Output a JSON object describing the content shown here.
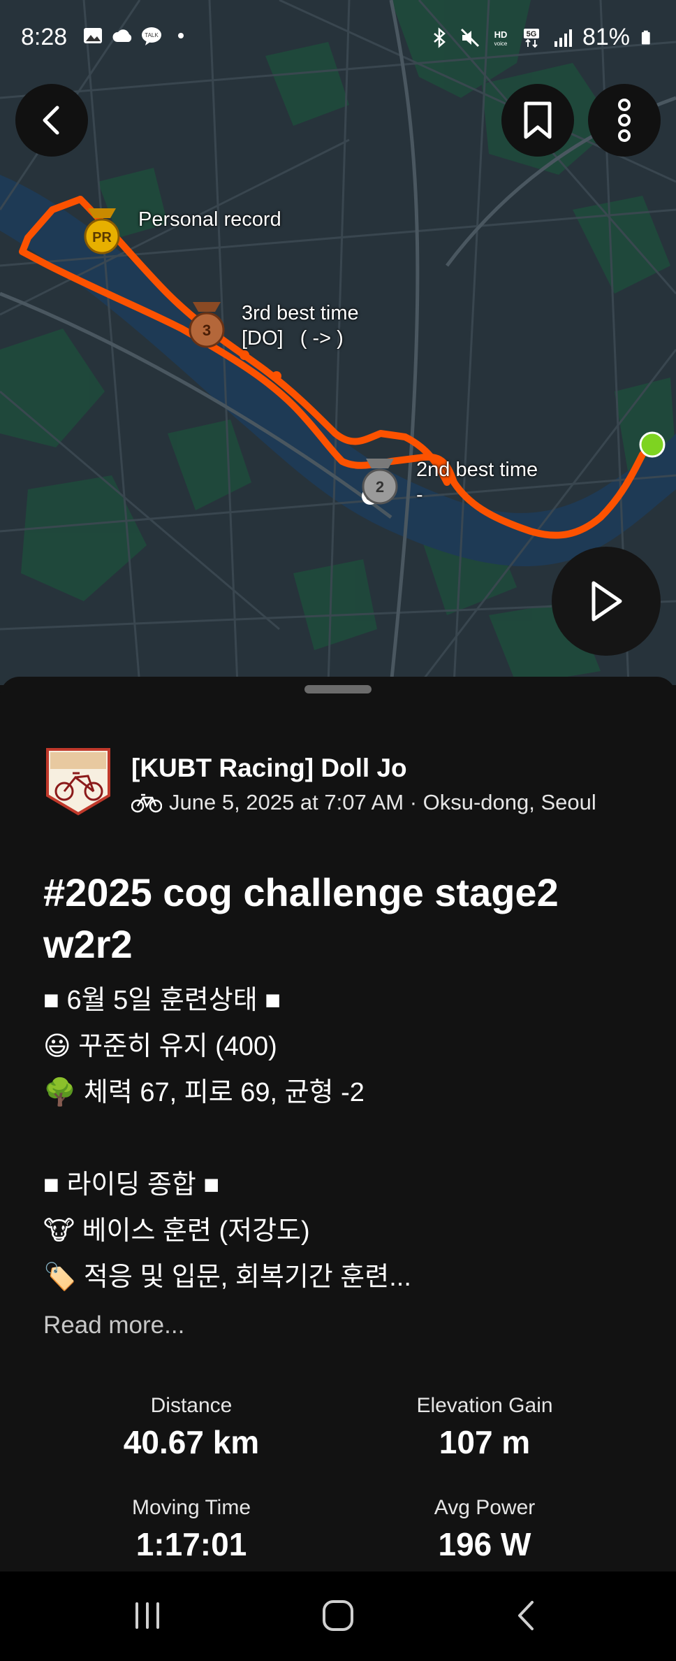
{
  "status_bar": {
    "time": "8:28",
    "battery": "81%",
    "left_icons": [
      "image-icon",
      "cloud-icon",
      "talk-icon",
      "dot-icon"
    ],
    "right_icons": [
      "bluetooth-icon",
      "mute-icon",
      "hd-voice-icon",
      "5g-icon",
      "signal-icon",
      "battery-icon"
    ]
  },
  "map": {
    "labels": {
      "pr": "Personal record",
      "third": "3rd best time\n[DO]   ( -> )",
      "second": "2nd best time\n-"
    },
    "medals": {
      "pr": "PR",
      "third": "3",
      "second": "2"
    },
    "colors": {
      "route": "#fc5200",
      "start": "#7ed321",
      "water": "#1e3a55",
      "land": "#26323a",
      "green": "#1d4d3e"
    }
  },
  "activity": {
    "athlete_name": "[KUBT Racing] Doll Jo",
    "meta": "June 5, 2025 at 7:07 AM · Oksu-dong, Seoul",
    "title": "#2025 cog challenge stage2 w2r2",
    "description_lines": [
      "■ 6월 5일 훈련상태 ■",
      "😃 꾸준히 유지 (400)",
      "🌳 체력 67, 피로 69, 균형 -2",
      "",
      "■ 라이딩 종합 ■",
      "🐮 베이스 훈련 (저강도)",
      "🏷️ 적응 및 입문, 회복기간 훈련..."
    ],
    "read_more": "Read more...",
    "stats": {
      "distance": {
        "label": "Distance",
        "value": "40.67 km"
      },
      "elevation": {
        "label": "Elevation Gain",
        "value": "107 m"
      },
      "moving_time": {
        "label": "Moving Time",
        "value": "1:17:01"
      },
      "avg_power": {
        "label": "Avg Power",
        "value": "196 W"
      }
    }
  }
}
